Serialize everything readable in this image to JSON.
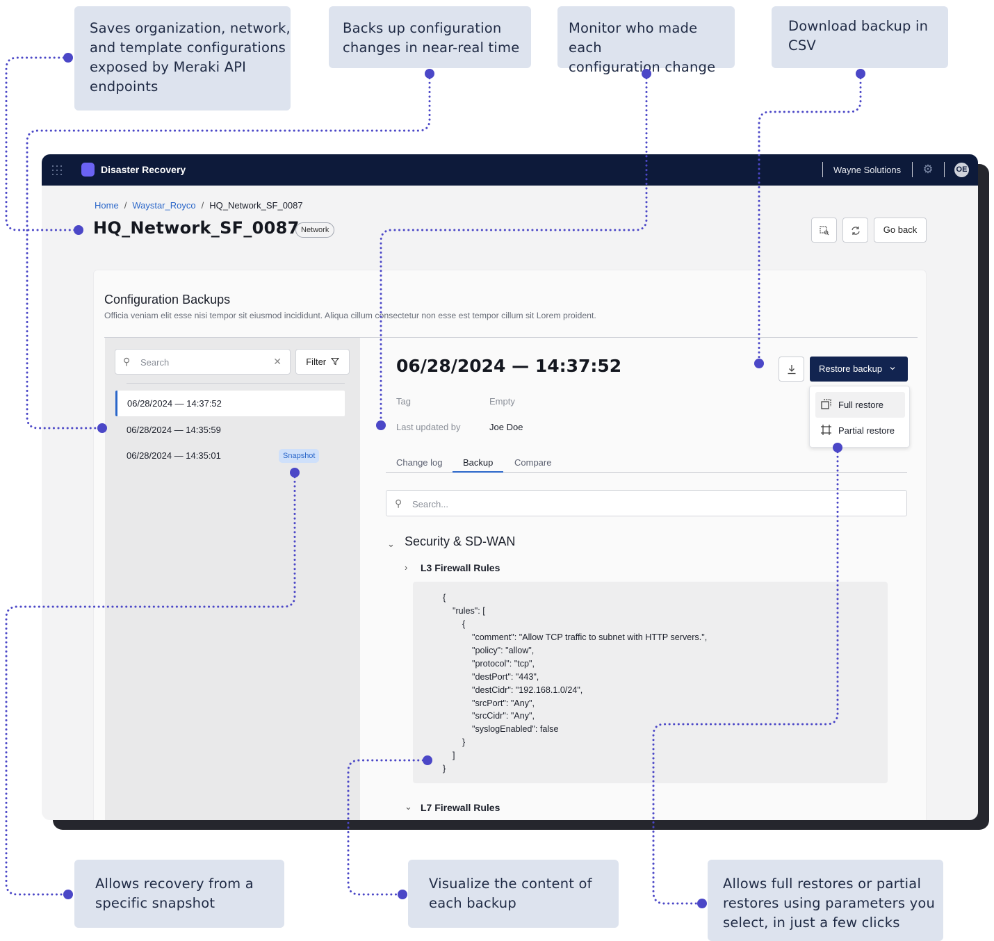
{
  "callouts": {
    "c1_l1": "Saves organization, network,",
    "c1_l2": "and template configurations",
    "c1_l3": "exposed by Meraki API",
    "c1_l4": "endpoints",
    "c2_l1": "Backs up configuration",
    "c2_l2": "changes in near-real time",
    "c3_l1": "Monitor who made each",
    "c3_l2": "configuration change",
    "c4_l1": "Download backup in",
    "c4_l2": "CSV",
    "c5_l1": "Allows recovery from a",
    "c5_l2": "specific snapshot",
    "c6_l1": "Visualize the content of",
    "c6_l2": "each backup",
    "c7_l1": "Allows full restores or partial",
    "c7_l2": "restores using parameters you",
    "c7_l3": "select, in just a few clicks"
  },
  "colors": {
    "callout_bg": "#dde3ee",
    "connector": "#4b47c7",
    "topbar": "#0d1a3a",
    "brand": "#6b63f3",
    "primary_button": "#122450",
    "link": "#2a66c9"
  },
  "app": {
    "title": "Disaster Recovery",
    "org": "Wayne Solutions",
    "avatar_initials": "OE",
    "icons": [
      "apps-grid-icon",
      "app-logo-icon",
      "gear-icon"
    ]
  },
  "breadcrumb": {
    "home": "Home",
    "org": "Waystar_Royco",
    "current": "HQ_Network_SF_0087",
    "sep": "/"
  },
  "page": {
    "title": "HQ_Network_SF_0087",
    "badge": "Network",
    "go_back": "Go back"
  },
  "card": {
    "title": "Configuration Backups",
    "description": "Officia veniam elit esse nisi tempor sit eiusmod incididunt. Aliqua cillum consectetur non esse est tempor cillum sit Lorem proident."
  },
  "list": {
    "search_placeholder": "Search",
    "filter_label": "Filter",
    "items": [
      {
        "label": "06/28/2024 — 14:37:52"
      },
      {
        "label": "06/28/2024 — 14:35:59"
      },
      {
        "label": "06/28/2024 — 14:35:01"
      }
    ],
    "snapshot_badge": "Snapshot"
  },
  "detail": {
    "title": "06/28/2024 — 14:37:52",
    "restore_label": "Restore backup",
    "full_restore": "Full restore",
    "partial_restore": "Partial restore",
    "tag_label": "Tag",
    "tag_value": "Empty",
    "updated_label": "Last updated by",
    "updated_value": "Joe Doe",
    "tabs": {
      "changelog": "Change log",
      "backup": "Backup",
      "compare": "Compare"
    },
    "search_placeholder": "Search...",
    "section_title": "Security & SD-WAN",
    "l3_title": "L3 Firewall Rules",
    "l7_title": "L7 Firewall Rules",
    "code": {
      "l1": "{",
      "l2": "\"rules\": [",
      "l3": "{",
      "l4": "\"comment\": \"Allow TCP traffic to subnet with HTTP servers.\",",
      "l5": "\"policy\": \"allow\",",
      "l6": "\"protocol\": \"tcp\",",
      "l7": "\"destPort\": \"443\",",
      "l8": "\"destCidr\": \"192.168.1.0/24\",",
      "l9": "\"srcPort\": \"Any\",",
      "l10": "\"srcCidr\": \"Any\",",
      "l11": "\"syslogEnabled\": false",
      "l12": "}",
      "l13": "]",
      "l14": "}"
    }
  }
}
